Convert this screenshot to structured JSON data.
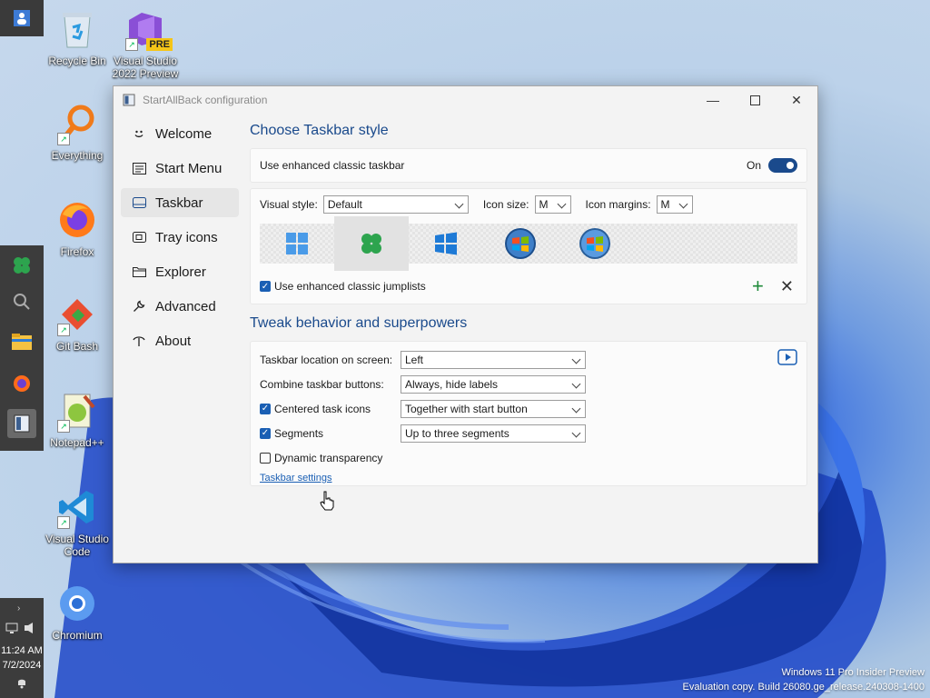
{
  "desktop": {
    "icons": [
      {
        "label": "Recycle Bin",
        "icon": "recycle-bin-icon"
      },
      {
        "label": "Visual Studio 2022 Preview",
        "icon": "visual-studio-icon",
        "badge": "PRE"
      },
      {
        "label": "Everything",
        "icon": "everything-search-icon"
      },
      {
        "label": "Firefox",
        "icon": "firefox-icon"
      },
      {
        "label": "Git Bash",
        "icon": "git-bash-icon"
      },
      {
        "label": "Notepad++",
        "icon": "notepad-plus-plus-icon"
      },
      {
        "label": "Visual Studio Code",
        "icon": "vscode-icon"
      },
      {
        "label": "Chromium",
        "icon": "chromium-icon"
      }
    ],
    "watermark": {
      "line1": "Windows 11 Pro Insider Preview",
      "line2": "Evaluation copy. Build 26080.ge_release.240308-1400"
    }
  },
  "taskbar": {
    "clock_time": "11:24 AM",
    "clock_date": "7/2/2024"
  },
  "window": {
    "title": "StartAllBack configuration",
    "nav": [
      {
        "label": "Welcome",
        "icon": "smiley-icon"
      },
      {
        "label": "Start Menu",
        "icon": "start-menu-icon"
      },
      {
        "label": "Taskbar",
        "icon": "taskbar-icon",
        "selected": true
      },
      {
        "label": "Tray icons",
        "icon": "tray-icons-icon"
      },
      {
        "label": "Explorer",
        "icon": "folder-icon"
      },
      {
        "label": "Advanced",
        "icon": "wrench-icon"
      },
      {
        "label": "About",
        "icon": "about-icon"
      }
    ],
    "section1_title": "Choose Taskbar style",
    "enhanced_label": "Use enhanced classic taskbar",
    "enhanced_state": "On",
    "visual_style_label": "Visual style:",
    "visual_style_value": "Default",
    "icon_size_label": "Icon size:",
    "icon_size_value": "M",
    "icon_margins_label": "Icon margins:",
    "icon_margins_value": "M",
    "jumplists_label": "Use enhanced classic jumplists",
    "section2_title": "Tweak behavior and superpowers",
    "location_label": "Taskbar location on screen:",
    "location_value": "Left",
    "combine_label": "Combine taskbar buttons:",
    "combine_value": "Always, hide labels",
    "centered_label": "Centered task icons",
    "centered_value": "Together with start button",
    "segments_label": "Segments",
    "segments_value": "Up to three segments",
    "transparency_label": "Dynamic transparency",
    "settings_link": "Taskbar settings"
  },
  "colors": {
    "accent": "#1a4a8c",
    "checkbox": "#1a5fb4",
    "plus_green": "#1f8a3a"
  }
}
